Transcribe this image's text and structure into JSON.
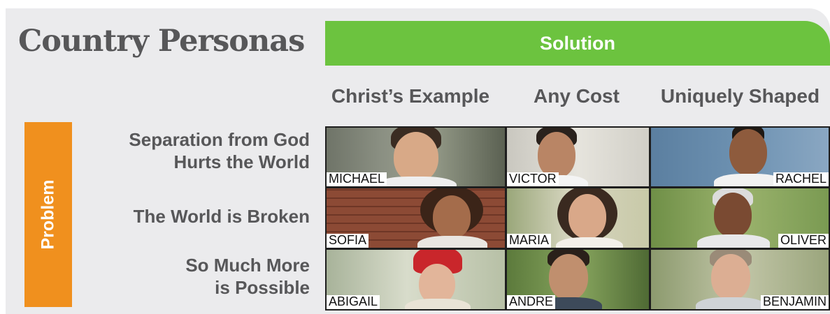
{
  "title": "Country Personas",
  "solution_label": "Solution",
  "problem_label": "Problem",
  "columns": [
    "Christ’s Example",
    "Any Cost",
    "Uniquely Shaped"
  ],
  "rows": [
    {
      "line1": "Separation from God",
      "line2": "Hurts the World"
    },
    {
      "line1": "The World is Broken",
      "line2": ""
    },
    {
      "line1": "So Much More",
      "line2": "is Possible"
    }
  ],
  "personas": [
    {
      "name": "MICHAEL"
    },
    {
      "name": "VICTOR"
    },
    {
      "name": "RACHEL"
    },
    {
      "name": "SOFIA"
    },
    {
      "name": "MARIA"
    },
    {
      "name": "OLIVER"
    },
    {
      "name": "ABIGAIL"
    },
    {
      "name": "ANDRE"
    },
    {
      "name": "BENJAMIN"
    }
  ],
  "colors": {
    "solution": "#6cc33f",
    "problem": "#f0901e",
    "text": "#575759",
    "panel": "#ebebed"
  }
}
